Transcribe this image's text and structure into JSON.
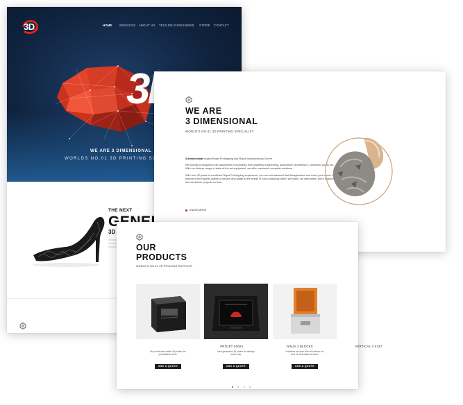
{
  "colors": {
    "hero_dark": "#0a1628",
    "accent_red": "#c42b1c",
    "button_dark": "#1d1d1d",
    "text_dark": "#111111"
  },
  "hero": {
    "logo_text": "3D",
    "nav": [
      "HOME",
      "SERVICES",
      "ABOUT US",
      "TECHNOLOGIES",
      "NEWS",
      "STORE",
      "CONTACT"
    ],
    "nav_active_index": 0,
    "big_3d": "3D",
    "headline": "WE ARE 3 DIMENSIONAL",
    "subline": "WORLDS NO.01 3D PRINTING SOLU",
    "next_label": "THE NEXT",
    "gen_word": "GENER",
    "threed_word": "3D"
  },
  "about": {
    "title_line1": "WE ARE",
    "title_line2": "3 DIMENSIONAL",
    "subtitle": "WORLD'S NO.01 3D PRINTING SPECIALIST",
    "lead_bold": "3 dimensional",
    "lead_rest": " largest Rapid Prototyping and Rapid Manufacturing Centre",
    "para1": "We provide prototypes to an assortment of industries from jewellery engineering, automotive, architecture, consumer goods etc. With our diverse range of state-of-the-art equipment, we offer customers complete solutions.",
    "para2": "With over 20 years of combined Rapid Prototyping experience, you can rest assured that 3imaginarium can meet your needs. We believe in the highest calibre of service and adapt to the needs of each individual client. We listen, we alternative, we're responsive, and we deliver projects on time.",
    "know_more": "KNOW MORE"
  },
  "products": {
    "title_line1": "OUR",
    "title_line2": "PRODUCTS",
    "subtitle": "WORLD'S NO.01 3D PRINTING SUPPLIER",
    "items": [
      {
        "name": "PROJET 5000X",
        "desc": "Buy world class tablet 3d printers for professional users.",
        "button": "ASK A QUOTE"
      },
      {
        "name": "NINJA 3 BLOCKS",
        "desc": "Next generation 3d printer for desktop users only.",
        "button": "ASK A QUOTE"
      },
      {
        "name": "VERTICAL 3 X157",
        "desc": "Industries we work with and deliver our best of world class services.",
        "button": "ASK A QUOTE"
      }
    ],
    "pager_count": 4,
    "pager_active": 0
  }
}
